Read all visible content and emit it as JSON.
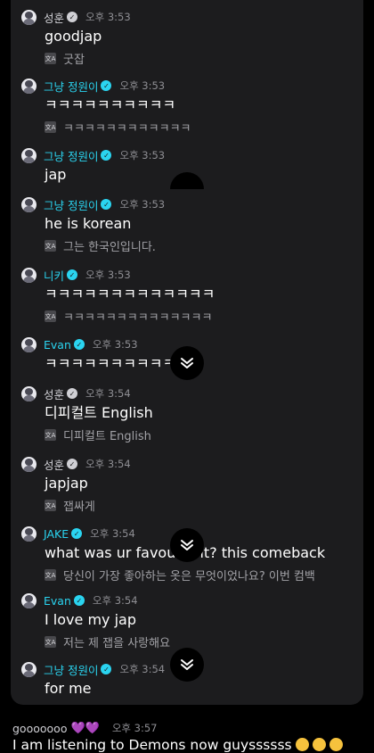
{
  "messages": [
    {
      "user": "성훈",
      "name_color": "grey",
      "time": "오후 3:53",
      "text": "goodjap",
      "translation": "굿잡"
    },
    {
      "user": "그냥 정원이",
      "name_color": "cyan",
      "time": "오후 3:53",
      "text": "ㅋㅋㅋㅋㅋㅋㅋㅋㅋㅋ",
      "translation": "ㅋㅋㅋㅋㅋㅋㅋㅋㅋㅋㅋㅋ"
    },
    {
      "user": "그냥 정원이",
      "name_color": "cyan",
      "time": "오후 3:53",
      "text": "jap",
      "translation": ""
    },
    {
      "user": "그냥 정원이",
      "name_color": "cyan",
      "time": "오후 3:53",
      "text": "he is korean",
      "translation": "그는 한국인입니다."
    },
    {
      "user": "니키",
      "name_color": "cyan",
      "time": "오후 3:53",
      "text": "ㅋㅋㅋㅋㅋㅋㅋㅋㅋㅋㅋㅋㅋ",
      "translation": "ㅋㅋㅋㅋㅋㅋㅋㅋㅋㅋㅋㅋㅋㅋ"
    },
    {
      "user": "Evan",
      "name_color": "cyan",
      "time": "오후 3:53",
      "text": "ㅋㅋㅋㅋㅋㅋㅋㅋㅋㅋ",
      "translation": ""
    },
    {
      "user": "성훈",
      "name_color": "grey",
      "time": "오후 3:54",
      "text": "디피컬트 English",
      "translation": "디피컬트 English"
    },
    {
      "user": "성훈",
      "name_color": "grey",
      "time": "오후 3:54",
      "text": "japjap",
      "translation": "잽싸게"
    },
    {
      "user": "JAKE",
      "name_color": "cyan",
      "time": "오후 3:54",
      "text": "what was ur favou   utfit? this comeback",
      "translation": "당신이 가장 좋아하는 옷은 무엇이었나요? 이번 컴백"
    },
    {
      "user": "Evan",
      "name_color": "cyan",
      "time": "오후 3:54",
      "text": "I love my jap",
      "translation": "저는 제 잽을 사랑해요"
    },
    {
      "user": "그냥 정원이",
      "name_color": "cyan",
      "time": "오후 3:54",
      "text": "for me",
      "translation": ""
    }
  ],
  "bottom_message": {
    "user": "gooooooo",
    "hearts": "💜💜",
    "time": "오후 3:57",
    "text": "I am listening to Demons now guyssssss"
  },
  "icons": {
    "verified": "verified-check-icon",
    "translate": "translate-icon",
    "scroll_down": "chevron-double-down-icon"
  }
}
